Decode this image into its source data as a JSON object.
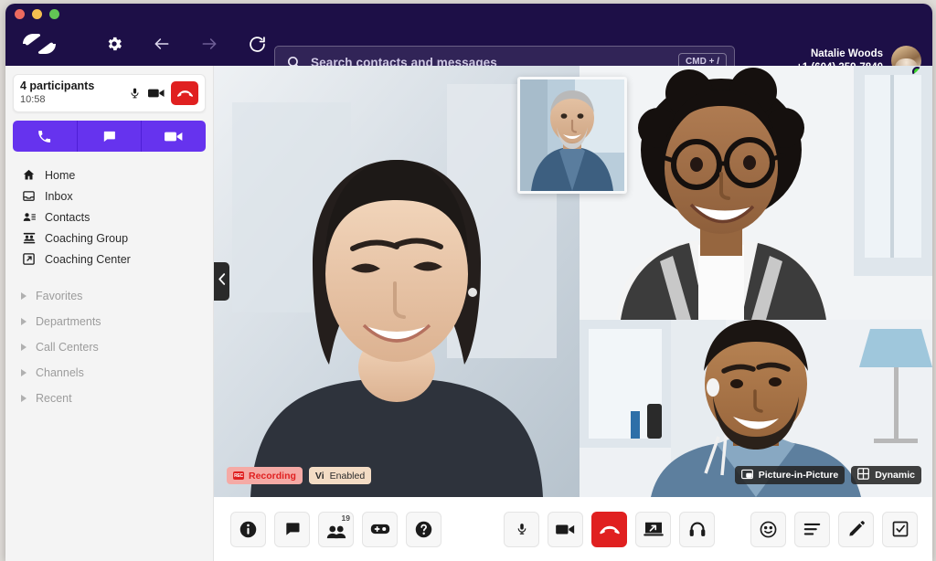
{
  "window": {
    "traffic_lights": [
      "close",
      "minimize",
      "maximize"
    ]
  },
  "header": {
    "logo_icon": "chat-bubbles-logo",
    "icons": [
      {
        "name": "gear-icon",
        "glyph": "settings"
      },
      {
        "name": "back-arrow-icon",
        "glyph": "arrow-left"
      },
      {
        "name": "forward-arrow-icon",
        "glyph": "arrow-right"
      },
      {
        "name": "refresh-icon",
        "glyph": "reload"
      }
    ],
    "search": {
      "icon": "search-icon",
      "placeholder": "Search contacts and messages",
      "value": "",
      "shortcut": "CMD + /"
    },
    "user": {
      "name": "Natalie Woods",
      "phone": "+1 (604) 359-7840",
      "avatar_icon": "user-avatar",
      "presence": "online"
    },
    "bg_color": "#1d0f47"
  },
  "sidebar": {
    "active_call": {
      "title": "4 participants",
      "duration": "10:58",
      "mic_icon": "microphone-icon",
      "video_icon": "video-camera-icon",
      "hangup_icon": "hangup-icon"
    },
    "quick_actions": [
      {
        "name": "call-action",
        "icon": "phone-icon"
      },
      {
        "name": "chat-action",
        "icon": "message-icon"
      },
      {
        "name": "video-action",
        "icon": "video-camera-icon"
      }
    ],
    "accent_color": "#6633ee",
    "nav_items": [
      {
        "label": "Home",
        "icon": "home-icon"
      },
      {
        "label": "Inbox",
        "icon": "inbox-icon"
      },
      {
        "label": "Contacts",
        "icon": "contacts-icon"
      },
      {
        "label": "Coaching Group",
        "icon": "group-icon"
      },
      {
        "label": "Coaching Center",
        "icon": "external-link-icon"
      }
    ],
    "groups": [
      {
        "label": "Favorites"
      },
      {
        "label": "Departments"
      },
      {
        "label": "Call Centers"
      },
      {
        "label": "Channels"
      },
      {
        "label": "Recent"
      }
    ]
  },
  "stage": {
    "collapse_icon": "chevron-left-icon",
    "participants": [
      {
        "name": "participant-main",
        "position": "main-left"
      },
      {
        "name": "participant-pip",
        "position": "picture-in-picture"
      },
      {
        "name": "participant-top-right",
        "position": "top-right"
      },
      {
        "name": "participant-bottom-right",
        "position": "bottom-right"
      }
    ],
    "badges_left": [
      {
        "name": "recording-badge",
        "chip": "REC",
        "label": "Recording",
        "color": "#e02020"
      },
      {
        "name": "vi-enabled-badge",
        "mark": "Vi",
        "label": "Enabled"
      }
    ],
    "badges_right": [
      {
        "name": "picture-in-picture-badge",
        "icon": "pip-icon",
        "label": "Picture-in-Picture"
      },
      {
        "name": "dynamic-layout-badge",
        "icon": "grid-icon",
        "label": "Dynamic"
      }
    ]
  },
  "toolbar": {
    "left": [
      {
        "name": "info-button",
        "icon": "info-icon"
      },
      {
        "name": "chat-button",
        "icon": "message-icon"
      },
      {
        "name": "participants-button",
        "icon": "people-icon",
        "badge": "19"
      },
      {
        "name": "dialpad-button",
        "icon": "add-call-icon"
      },
      {
        "name": "help-button",
        "icon": "question-icon"
      }
    ],
    "middle": [
      {
        "name": "mute-button",
        "icon": "microphone-icon"
      },
      {
        "name": "camera-button",
        "icon": "video-camera-icon"
      },
      {
        "name": "end-call-button",
        "icon": "hangup-icon",
        "danger": true
      },
      {
        "name": "share-screen-button",
        "icon": "screen-share-icon"
      },
      {
        "name": "audio-device-button",
        "icon": "headset-icon"
      }
    ],
    "right": [
      {
        "name": "reactions-button",
        "icon": "smiley-icon"
      },
      {
        "name": "transcript-button",
        "icon": "lines-icon"
      },
      {
        "name": "notes-button",
        "icon": "pencil-icon"
      },
      {
        "name": "tasks-button",
        "icon": "checkbox-icon"
      }
    ],
    "danger_color": "#e02020"
  }
}
